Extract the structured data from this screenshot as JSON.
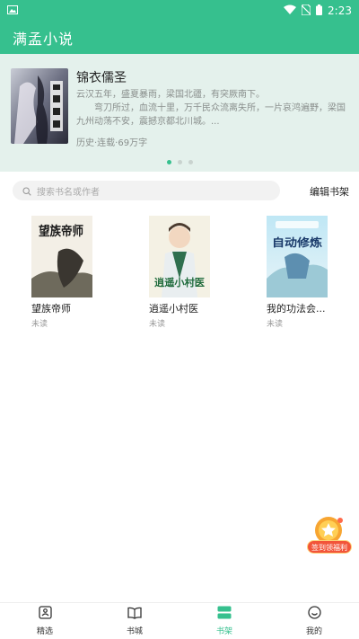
{
  "status_bar": {
    "time": "2:23",
    "icons": [
      "image-icon",
      "wifi-icon",
      "no-sim-icon",
      "battery-icon"
    ]
  },
  "app_bar": {
    "title": "满孟小说"
  },
  "banner": {
    "title": "锦衣儒圣",
    "desc_lines": [
      "云汉五年，盛夏暴雨，梁国北疆，有突厥南下。",
      "弯刀所过，血流十里，万千民众流离失所，一片哀鸿遍野，梁国十",
      "九州动荡不安，震撼京都北川城。..."
    ],
    "meta": "历史·连载·69万字",
    "page_count": 3,
    "active_page": 1
  },
  "search": {
    "placeholder": "搜索书名或作者"
  },
  "shelf": {
    "edit_label": "编辑书架",
    "books": [
      {
        "title": "望族帝师",
        "status": "未读",
        "cover_text": "望族帝师"
      },
      {
        "title": "逍遥小村医",
        "status": "未读",
        "cover_text": "逍遥小村医"
      },
      {
        "title": "我的功法会...",
        "status": "未读",
        "cover_text": "自动修炼"
      }
    ]
  },
  "checkin": {
    "label": "签到领福利"
  },
  "bottom_nav": {
    "items": [
      {
        "label": "精选",
        "icon": "featured-icon"
      },
      {
        "label": "书城",
        "icon": "open-book-icon"
      },
      {
        "label": "书架",
        "icon": "bookshelf-icon"
      },
      {
        "label": "我的",
        "icon": "smile-face-icon"
      }
    ],
    "active": "书架"
  },
  "colors": {
    "primary": "#36c08e",
    "banner_bg": "#e4f1ec",
    "text_muted": "#8a8f8d",
    "checkin_red": "#f2553a"
  }
}
